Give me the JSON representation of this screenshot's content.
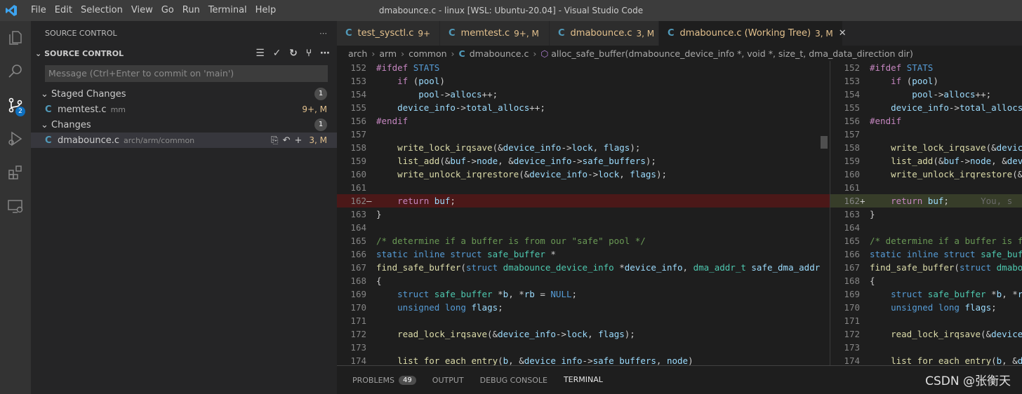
{
  "menu": [
    "File",
    "Edit",
    "Selection",
    "View",
    "Go",
    "Run",
    "Terminal",
    "Help"
  ],
  "window_title": "dmabounce.c - linux [WSL: Ubuntu-20.04] - Visual Studio Code",
  "activity": {
    "scm_badge": "2"
  },
  "sidebar": {
    "title": "SOURCE CONTROL",
    "section": "SOURCE CONTROL",
    "message_placeholder": "Message (Ctrl+Enter to commit on 'main')",
    "staged": {
      "label": "Staged Changes",
      "count": "1",
      "file": {
        "name": "memtest.c",
        "dir": "mm",
        "status": "9+, M"
      }
    },
    "changes": {
      "label": "Changes",
      "count": "1",
      "file": {
        "name": "dmabounce.c",
        "dir": "arch/arm/common",
        "status": "3, M"
      }
    }
  },
  "tabs": [
    {
      "name": "test_sysctl.c",
      "status": "9+"
    },
    {
      "name": "memtest.c",
      "status": "9+, M"
    },
    {
      "name": "dmabounce.c",
      "status": "3, M"
    },
    {
      "name": "dmabounce.c (Working Tree)",
      "status": "3, M"
    }
  ],
  "breadcrumb": [
    "arch",
    "arm",
    "common",
    "dmabounce.c",
    "alloc_safe_buffer(dmabounce_device_info *, void *, size_t, dma_data_direction dir)"
  ],
  "panel_tabs": {
    "problems": "PROBLEMS",
    "problems_count": "49",
    "output": "OUTPUT",
    "debug": "DEBUG CONSOLE",
    "terminal": "TERMINAL"
  },
  "blame": "You, s",
  "watermark": "CSDN @张衡天",
  "colors": {
    "accent": "#0e70c0",
    "deleted": "#4b1818",
    "added": "#373d29",
    "modified": "#e2c08d"
  }
}
